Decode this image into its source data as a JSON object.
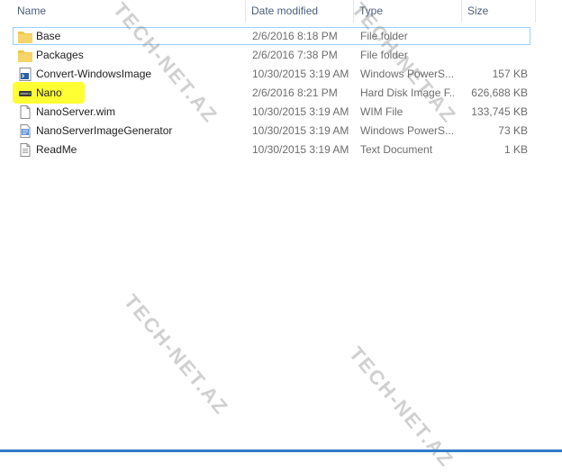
{
  "columns": {
    "name": "Name",
    "date": "Date modified",
    "type": "Type",
    "size": "Size"
  },
  "files": [
    {
      "name": "Base",
      "date": "2/6/2016 8:18 PM",
      "type": "File folder",
      "size": "",
      "icon": "folder-icon"
    },
    {
      "name": "Packages",
      "date": "2/6/2016 7:38 PM",
      "type": "File folder",
      "size": "",
      "icon": "folder-icon"
    },
    {
      "name": "Convert-WindowsImage",
      "date": "10/30/2015 3:19 AM",
      "type": "Windows PowerS...",
      "size": "157 KB",
      "icon": "powershell-script-icon"
    },
    {
      "name": "Nano",
      "date": "2/6/2016 8:21 PM",
      "type": "Hard Disk Image F...",
      "size": "626,688 KB",
      "icon": "disk-image-icon"
    },
    {
      "name": "NanoServer.wim",
      "date": "10/30/2015 3:19 AM",
      "type": "WIM File",
      "size": "133,745 KB",
      "icon": "file-icon"
    },
    {
      "name": "NanoServerImageGenerator",
      "date": "10/30/2015 3:19 AM",
      "type": "Windows PowerS...",
      "size": "73 KB",
      "icon": "powershell-module-icon"
    },
    {
      "name": "ReadMe",
      "date": "10/30/2015 3:19 AM",
      "type": "Text Document",
      "size": "1 KB",
      "icon": "text-document-icon"
    }
  ],
  "watermark": "TECH-NET.AZ",
  "colors": {
    "highlight": "#ffff33",
    "selection_border": "#99d1ff",
    "folder": "#f0c64a",
    "accent": "#2f7dc8"
  }
}
